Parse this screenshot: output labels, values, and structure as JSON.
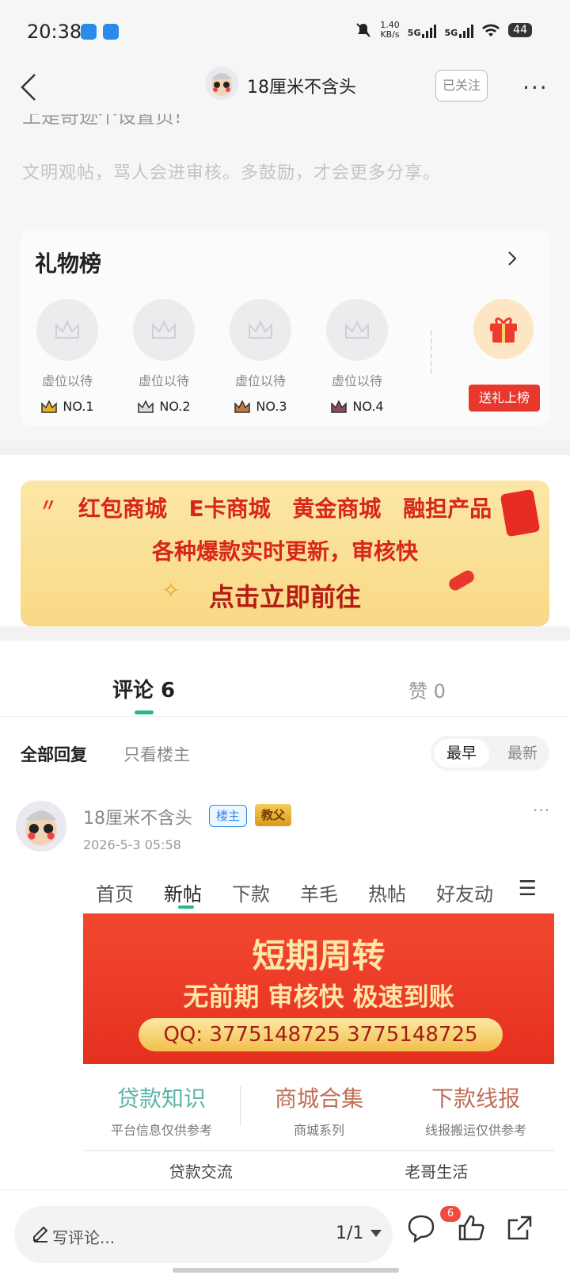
{
  "status_bar": {
    "time": "20:38",
    "net_speed": "1.40",
    "net_unit": "KB/s",
    "signal_1": "5G",
    "signal_2": "5G",
    "battery": "44"
  },
  "header": {
    "title": "18厘米不含头",
    "follow_label": "已关注",
    "more_label": "···"
  },
  "post": {
    "cut_text": "上是奇迹个设置页!",
    "notice": "文明观帖，骂人会进审核。多鼓励，才会更多分享。"
  },
  "gift_board": {
    "title": "礼物榜",
    "slots": [
      {
        "label": "虚位以待",
        "rank": "NO.1",
        "crown_color": "#e6b422"
      },
      {
        "label": "虚位以待",
        "rank": "NO.2",
        "crown_color": "#777788"
      },
      {
        "label": "虚位以待",
        "rank": "NO.3",
        "crown_color": "#c07a45"
      },
      {
        "label": "虚位以待",
        "rank": "NO.4",
        "crown_color": "#8a4b6a"
      }
    ],
    "send_label": "送礼上榜"
  },
  "banner": {
    "line1": "红包商城 E卡商城 黄金商城 融担产品",
    "line2": "各种爆款实时更新，审核快",
    "line3": "点击立即前往"
  },
  "tabs": {
    "comments": "评论 6",
    "likes": "赞 0"
  },
  "filter": {
    "all": "全部回复",
    "owner_only": "只看楼主",
    "earliest": "最早",
    "latest": "最新"
  },
  "comment": {
    "author": "18厘米不含头",
    "badge_owner": "楼主",
    "badge_level": "教父",
    "time": "2026-5-3 05:58",
    "more": "···",
    "image": {
      "nav": [
        "首页",
        "新帖",
        "下款",
        "羊毛",
        "热帖",
        "好友动"
      ],
      "headline": "短期周转",
      "subline": "无前期 审核快 极速到账",
      "qq": "QQ: 3775148725 3775148725",
      "grid": [
        {
          "title": "贷款知识",
          "desc": "平台信息仅供参考"
        },
        {
          "title": "商城合集",
          "desc": "商城系列"
        },
        {
          "title": "下款线报",
          "desc": "线报搬运仅供参考"
        }
      ],
      "row2": [
        "贷款交流",
        "老哥生活"
      ]
    }
  },
  "bottom_bar": {
    "placeholder": "写评论...",
    "page": "1/1",
    "comment_count": "6"
  },
  "colors": {
    "accent": "#2cb693",
    "red": "#e8382d",
    "blue": "#2c8ae8"
  }
}
